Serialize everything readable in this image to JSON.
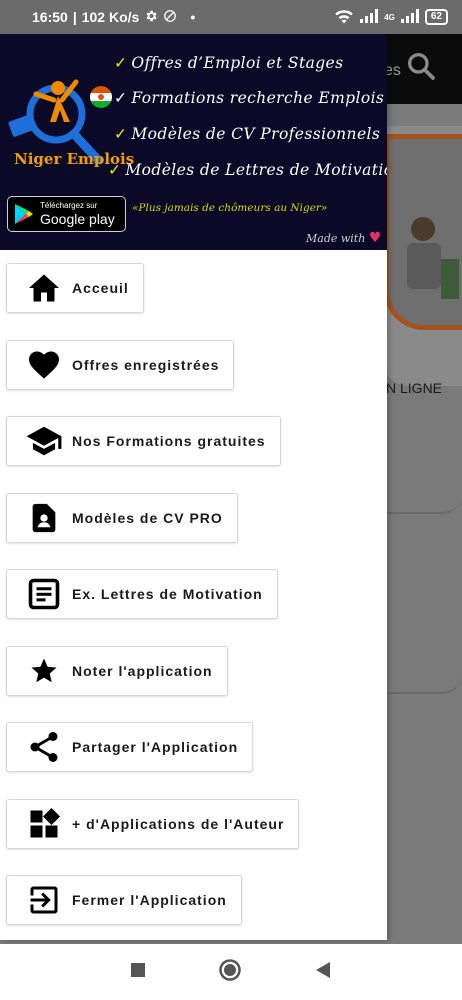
{
  "status_bar": {
    "time": "16:50",
    "speed": "102 Ko/s",
    "dot": "•",
    "network": "4G",
    "battery": "62"
  },
  "background": {
    "search_text": "es",
    "card_text": "N LIGNE"
  },
  "banner": {
    "brand": "Niger Emplois",
    "features": [
      "Offres d’Emploi et Stages",
      "Formations recherche Emplois",
      "Modèles de CV Professionnels",
      "Modèles de Lettres de Motivation"
    ],
    "gplay_small": "Téléchargez sur",
    "gplay_big": "Google play",
    "slogan": "«Plus jamais de chômeurs au Niger»",
    "made_with": "Made with"
  },
  "menu": [
    {
      "label": "Acceuil",
      "icon": "home-icon"
    },
    {
      "label": "Offres enregistrées",
      "icon": "heart-icon"
    },
    {
      "label": "Nos Formations gratuites",
      "icon": "graduation-cap-icon"
    },
    {
      "label": "Modèles de CV PRO",
      "icon": "cv-document-icon"
    },
    {
      "label": "Ex. Lettres de Motivation",
      "icon": "letter-icon"
    },
    {
      "label": "Noter l'application",
      "icon": "star-icon"
    },
    {
      "label": "Partager l'Application",
      "icon": "share-icon"
    },
    {
      "label": "+ d'Applications de l'Auteur",
      "icon": "more-apps-icon"
    },
    {
      "label": "Fermer l'Application",
      "icon": "exit-icon"
    }
  ],
  "colors": {
    "banner_bg": "#0a0a28",
    "check_yellow": "#e8e800",
    "heart": "#e0335e"
  }
}
